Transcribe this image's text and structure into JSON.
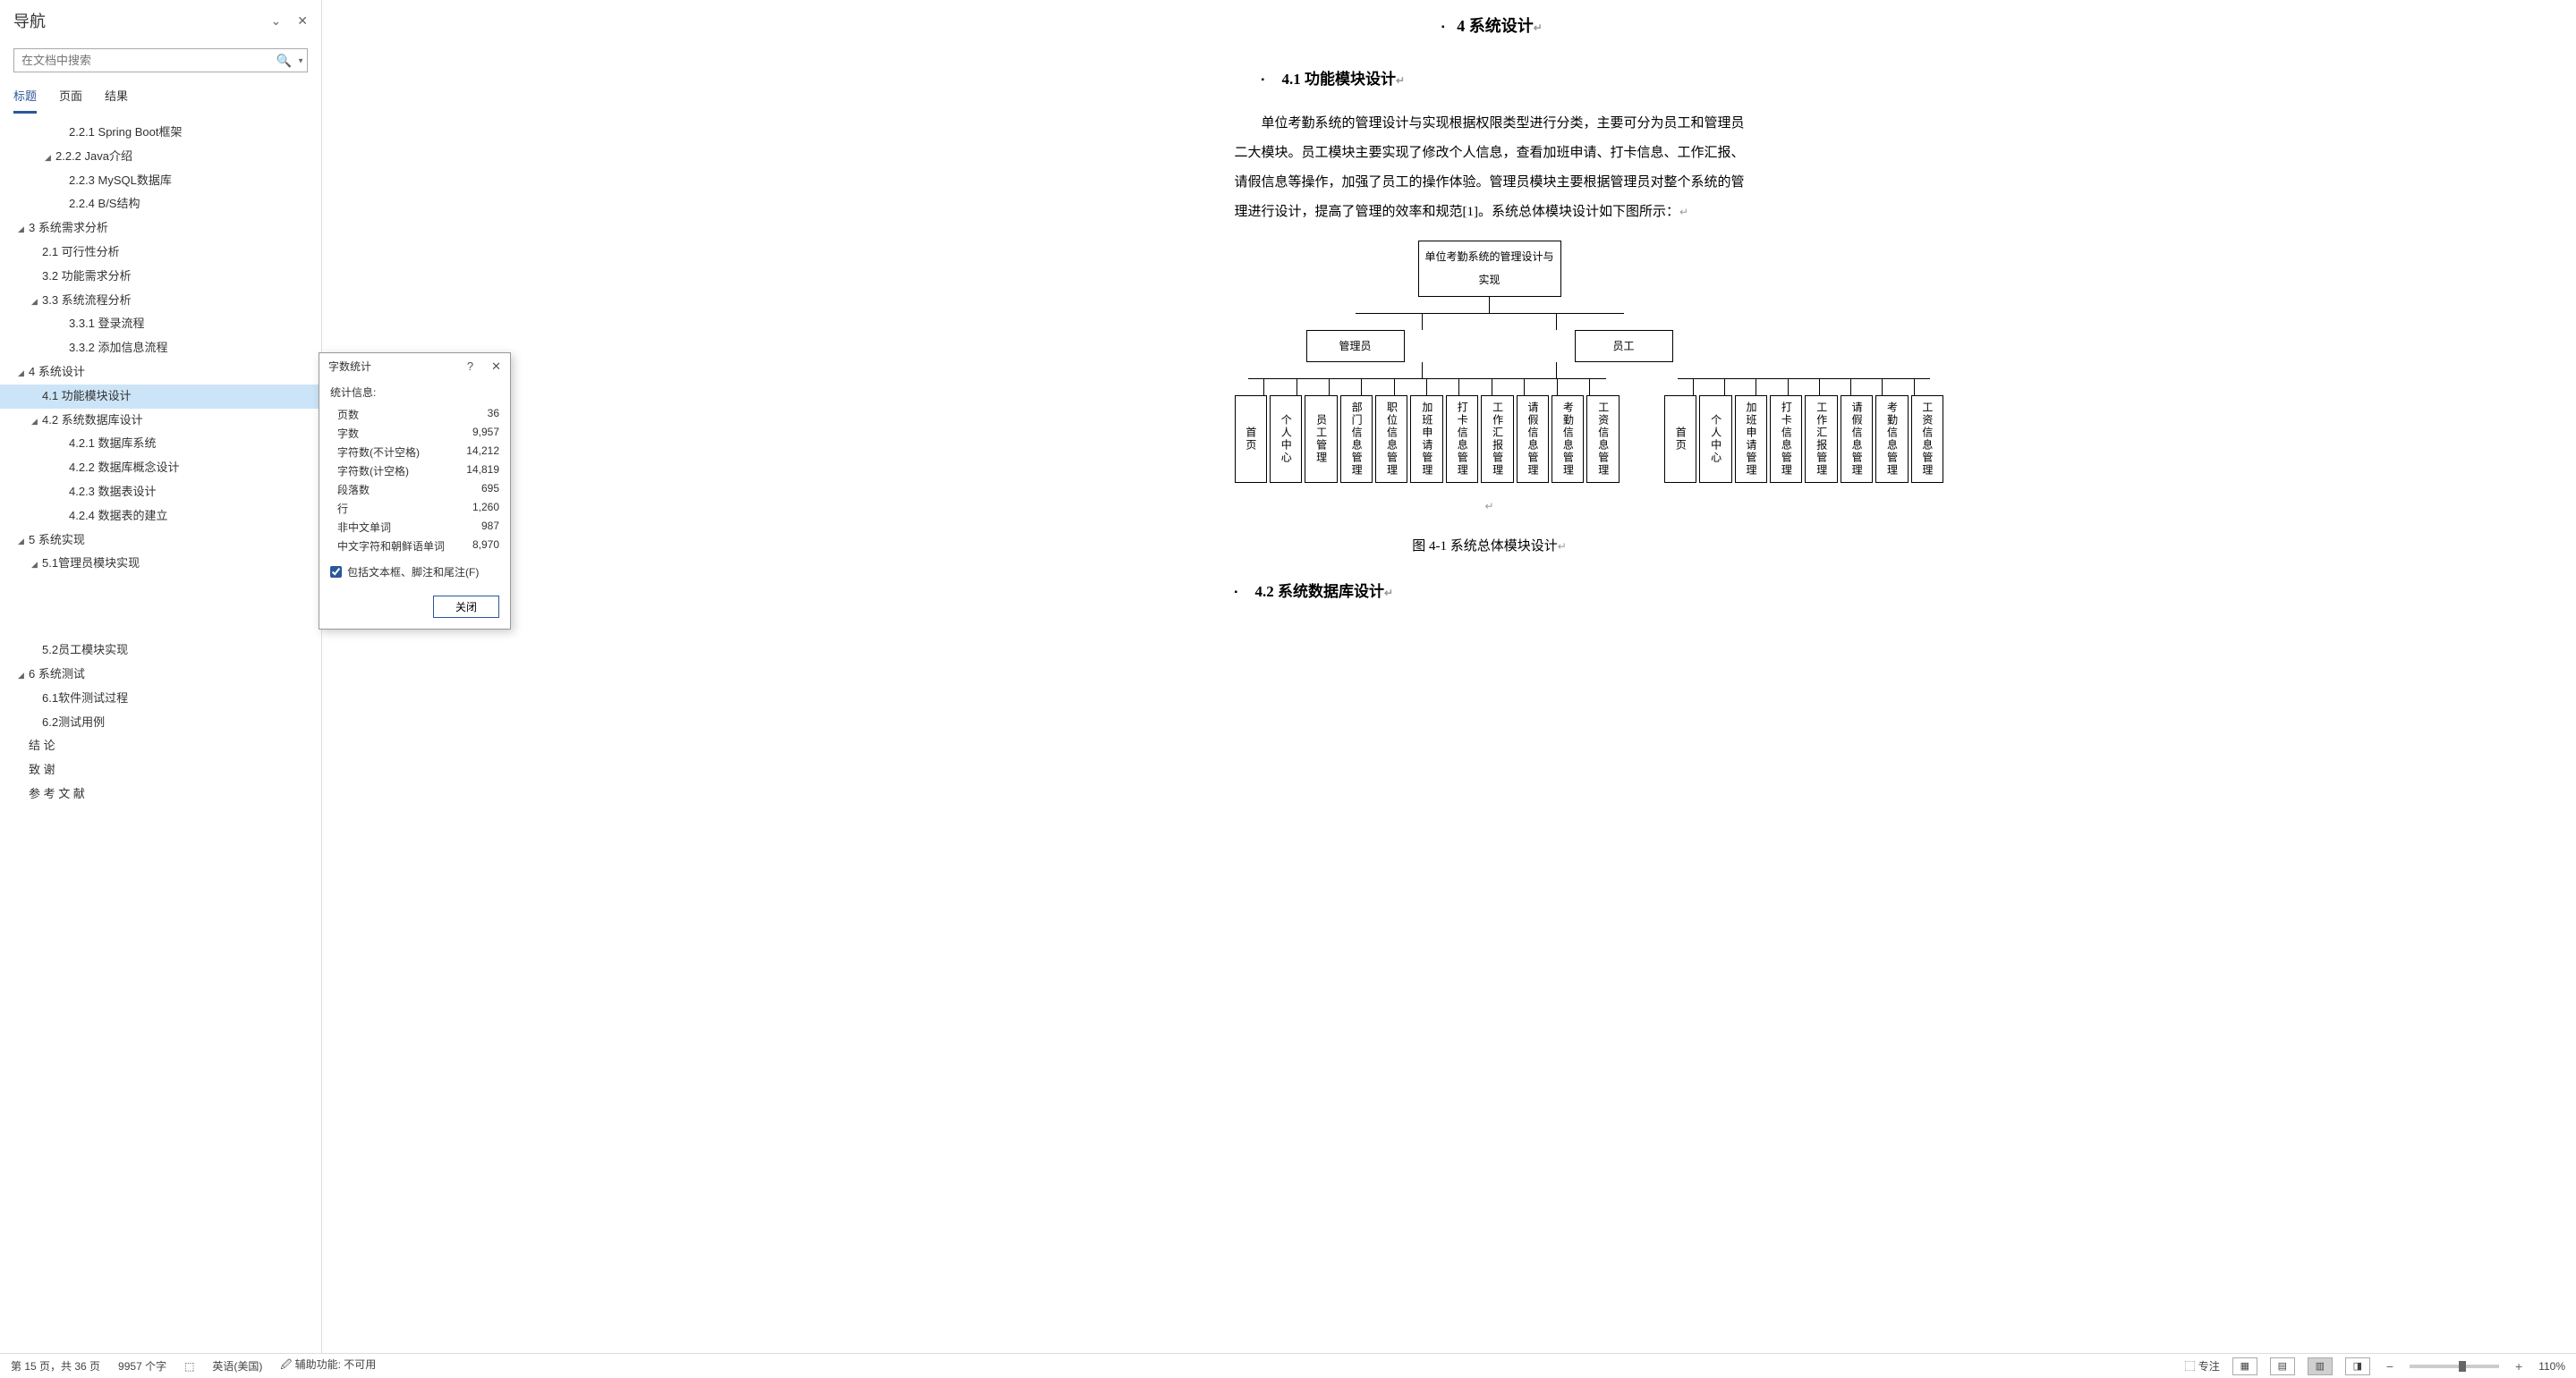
{
  "nav": {
    "title": "导航",
    "search_placeholder": "在文档中搜索",
    "tabs": [
      "标题",
      "页面",
      "结果"
    ],
    "tree": [
      {
        "level": 4,
        "caret": "",
        "label": "2.2.1 Spring Boot框架"
      },
      {
        "level": 3,
        "caret": "◢",
        "label": "2.2.2 Java介绍"
      },
      {
        "level": 4,
        "caret": "",
        "label": "2.2.3 MySQL数据库"
      },
      {
        "level": 4,
        "caret": "",
        "label": "2.2.4 B/S结构"
      },
      {
        "level": 1,
        "caret": "◢",
        "label": "3  系统需求分析"
      },
      {
        "level": 2,
        "caret": "",
        "label": "2.1 可行性分析"
      },
      {
        "level": 2,
        "caret": "",
        "label": "3.2 功能需求分析"
      },
      {
        "level": 2,
        "caret": "◢",
        "label": "3.3 系统流程分析"
      },
      {
        "level": 4,
        "caret": "",
        "label": "3.3.1 登录流程"
      },
      {
        "level": 4,
        "caret": "",
        "label": "3.3.2 添加信息流程"
      },
      {
        "level": 1,
        "caret": "◢",
        "label": "4  系统设计"
      },
      {
        "level": 2,
        "caret": "",
        "label": "4.1 功能模块设计",
        "selected": true
      },
      {
        "level": 2,
        "caret": "◢",
        "label": "4.2 系统数据库设计"
      },
      {
        "level": 4,
        "caret": "",
        "label": "4.2.1 数据库系统"
      },
      {
        "level": 4,
        "caret": "",
        "label": "4.2.2 数据库概念设计"
      },
      {
        "level": 4,
        "caret": "",
        "label": "4.2.3 数据表设计"
      },
      {
        "level": 4,
        "caret": "",
        "label": "4.2.4 数据表的建立"
      },
      {
        "level": 1,
        "caret": "◢",
        "label": "5  系统实现"
      },
      {
        "level": 2,
        "caret": "◢",
        "label": "5.1管理员模块实现"
      },
      {
        "gap": true
      },
      {
        "level": 2,
        "caret": "",
        "label": "5.2员工模块实现"
      },
      {
        "level": 1,
        "caret": "◢",
        "label": "6 系统测试"
      },
      {
        "level": 2,
        "caret": "",
        "label": "6.1软件测试过程"
      },
      {
        "level": 2,
        "caret": "",
        "label": "6.2测试用例"
      },
      {
        "level": 1,
        "caret": "",
        "label": "结  论"
      },
      {
        "level": 1,
        "caret": "",
        "label": "致  谢"
      },
      {
        "level": 1,
        "caret": "",
        "label": "参 考 文 献"
      }
    ]
  },
  "doc": {
    "h1": "4  系统设计",
    "h2_1": "4.1 功能模块设计",
    "paragraph": "单位考勤系统的管理设计与实现根据权限类型进行分类，主要可分为员工和管理员二大模块。员工模块主要实现了修改个人信息，查看加班申请、打卡信息、工作汇报、请假信息等操作，加强了员工的操作体验。管理员模块主要根据管理员对整个系统的管理进行设计，提高了管理的效率和规范[1]。系统总体模块设计如下图所示：",
    "chart": {
      "root": "单位考勤系统的管理设计与实现",
      "level2": [
        "管理员",
        "员工"
      ],
      "admin_leaves": [
        "首页",
        "个人中心",
        "员工管理",
        "部门信息管理",
        "职位信息管理",
        "加班申请管理",
        "打卡信息管理",
        "工作汇报管理",
        "请假信息管理",
        "考勤信息管理",
        "工资信息管理"
      ],
      "staff_leaves": [
        "首页",
        "个人中心",
        "加班申请管理",
        "打卡信息管理",
        "工作汇报管理",
        "请假信息管理",
        "考勤信息管理",
        "工资信息管理"
      ]
    },
    "caption": "图 4-1  系统总体模块设计",
    "h2_2": "4.2 系统数据库设计"
  },
  "dialog": {
    "title": "字数统计",
    "subtitle": "统计信息:",
    "rows": [
      {
        "label": "页数",
        "value": "36"
      },
      {
        "label": "字数",
        "value": "9,957"
      },
      {
        "label": "字符数(不计空格)",
        "value": "14,212"
      },
      {
        "label": "字符数(计空格)",
        "value": "14,819"
      },
      {
        "label": "段落数",
        "value": "695"
      },
      {
        "label": "行",
        "value": "1,260"
      },
      {
        "label": "非中文单词",
        "value": "987"
      },
      {
        "label": "中文字符和朝鲜语单词",
        "value": "8,970"
      }
    ],
    "checkbox_label": "包括文本框、脚注和尾注(F)",
    "close_btn": "关闭"
  },
  "status": {
    "page": "第 15 页，共 36 页",
    "words": "9957 个字",
    "language": "英语(美国)",
    "accessibility": "辅助功能: 不可用",
    "focus": "专注",
    "zoom": "110%"
  }
}
